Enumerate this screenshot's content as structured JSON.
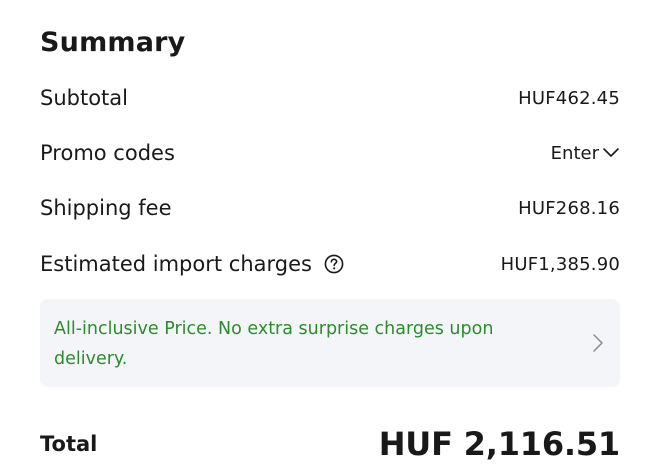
{
  "summary": {
    "title": "Summary",
    "subtotal": {
      "label": "Subtotal",
      "value": "HUF462.45"
    },
    "promo_codes": {
      "label": "Promo codes",
      "action_label": "Enter",
      "action_icon": "chevron-down-icon"
    },
    "shipping_fee": {
      "label": "Shipping fee",
      "value": "HUF268.16"
    },
    "import_charges": {
      "label": "Estimated import charges",
      "value": "HUF1,385.90",
      "icon": "question-circle-icon"
    },
    "notice": {
      "text": "All-inclusive Price. No extra surprise charges upon delivery.",
      "color": "#2d8b2d",
      "icon": "chevron-right-icon"
    },
    "total": {
      "label": "Total",
      "value": "HUF 2,116.51"
    }
  }
}
